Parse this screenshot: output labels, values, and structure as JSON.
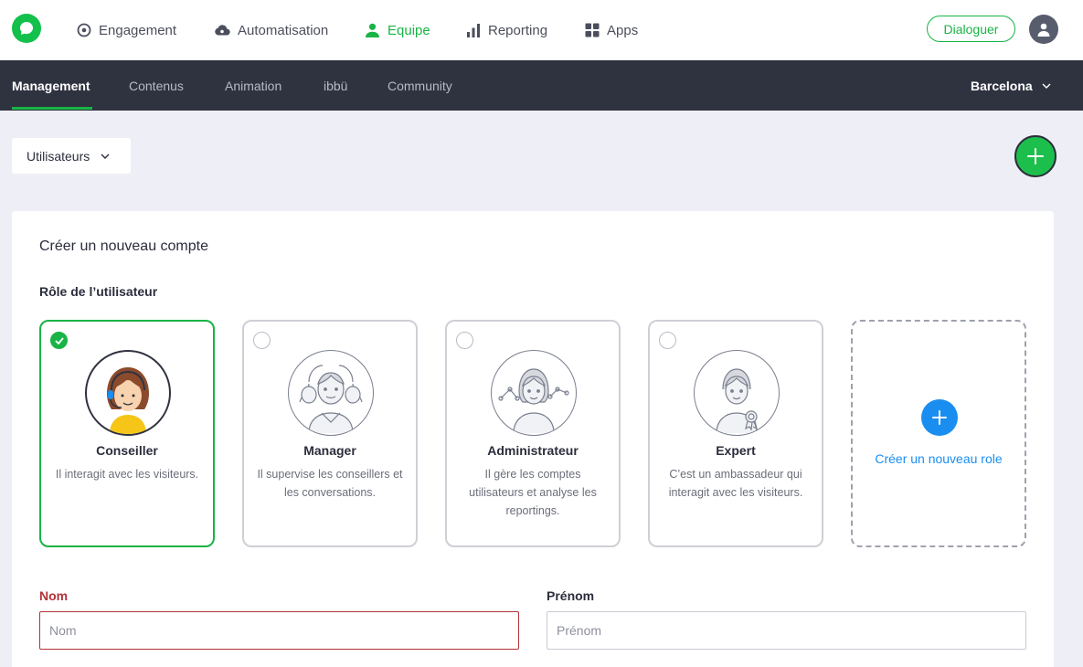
{
  "topnav": {
    "items": [
      {
        "label": "Engagement",
        "icon": "target-icon"
      },
      {
        "label": "Automatisation",
        "icon": "cloud-gear-icon"
      },
      {
        "label": "Equipe",
        "icon": "person-icon",
        "active": true
      },
      {
        "label": "Reporting",
        "icon": "bar-chart-icon"
      },
      {
        "label": "Apps",
        "icon": "grid-icon"
      }
    ],
    "dialog_button": "Dialoguer"
  },
  "subnav": {
    "items": [
      "Management",
      "Contenus",
      "Animation",
      "ibbü",
      "Community"
    ],
    "active": "Management",
    "location": "Barcelona"
  },
  "toolbar": {
    "select_label": "Utilisateurs"
  },
  "form": {
    "title": "Créer un nouveau compte",
    "role_label": "Rôle de l’utilisateur",
    "roles": [
      {
        "name": "Conseiller",
        "desc": "Il interagit avec les visiteurs.",
        "selected": true
      },
      {
        "name": "Manager",
        "desc": "Il supervise les conseillers et les conversations.",
        "selected": false
      },
      {
        "name": "Administrateur",
        "desc": "Il gère les comptes utilisateurs et analyse les reportings.",
        "selected": false
      },
      {
        "name": "Expert",
        "desc": "C’est un ambassadeur qui interagit avec les visiteurs.",
        "selected": false
      }
    ],
    "new_role": "Créer un nouveau role",
    "fields": {
      "nom_label": "Nom",
      "nom_placeholder": "Nom",
      "prenom_label": "Prénom",
      "prenom_placeholder": "Prénom"
    }
  },
  "colors": {
    "brand_green": "#19b446",
    "dark_nav": "#2f3340",
    "link_blue": "#1a8ef0",
    "error_red": "#b33237"
  }
}
